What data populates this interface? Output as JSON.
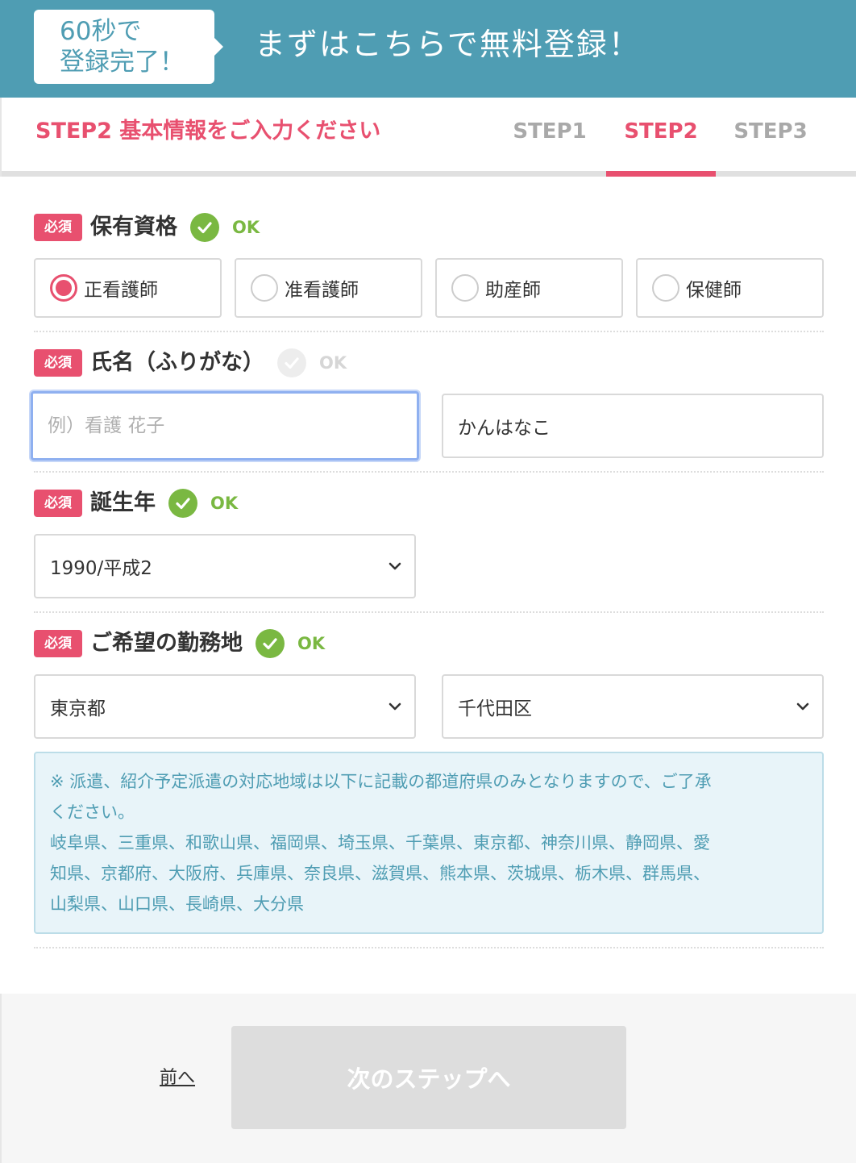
{
  "header": {
    "badge_line1": "60秒で",
    "badge_line2": "登録完了！",
    "title": "まずはこちらで無料登録！"
  },
  "steps": {
    "heading": "STEP2 基本情報をご入力ください",
    "tabs": [
      {
        "label": "STEP1",
        "active": false
      },
      {
        "label": "STEP2",
        "active": true
      },
      {
        "label": "STEP3",
        "active": false
      }
    ]
  },
  "required_label": "必須",
  "qualification": {
    "label": "保有資格",
    "status": "OK",
    "options": [
      {
        "label": "正看護師",
        "checked": true
      },
      {
        "label": "准看護師",
        "checked": false
      },
      {
        "label": "助産師",
        "checked": false
      },
      {
        "label": "保健師",
        "checked": false
      }
    ]
  },
  "name": {
    "label": "氏名（ふりがな）",
    "status": "OK",
    "placeholder": "例）看護 花子",
    "value": "",
    "furigana_value": "かんはなこ"
  },
  "birth_year": {
    "label": "誕生年",
    "status": "OK",
    "selected": "1990/平成2"
  },
  "work_location": {
    "label": "ご希望の勤務地",
    "status": "OK",
    "prefecture": "東京都",
    "city": "千代田区"
  },
  "notice": {
    "line1": "※ 派遣、紹介予定派遣の対応地域は以下に記載の都道府県のみとなりますので、ご了承",
    "line2": "ください。",
    "line3": "岐阜県、三重県、和歌山県、福岡県、埼玉県、千葉県、東京都、神奈川県、静岡県、愛",
    "line4": "知県、京都府、大阪府、兵庫県、奈良県、滋賀県、熊本県、茨城県、栃木県、群馬県、",
    "line5": "山梨県、山口県、長崎県、大分県"
  },
  "footer": {
    "back_label": "前へ",
    "next_label": "次のステップへ"
  },
  "colors": {
    "header_bg": "#4f9db3",
    "accent_pink": "#e8506f",
    "ok_green": "#7ab842",
    "notice_bg": "#e8f4f9",
    "disabled_button": "#dddddd"
  }
}
